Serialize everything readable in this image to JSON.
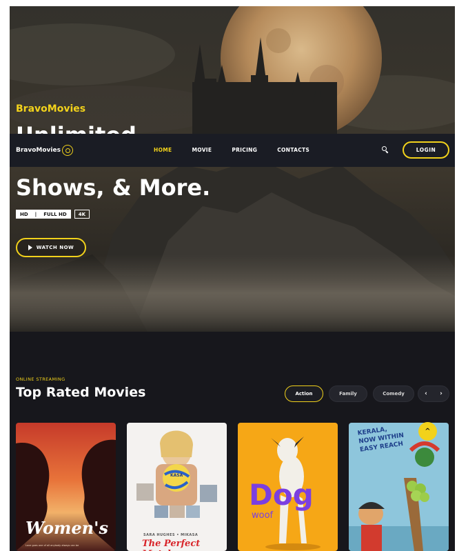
{
  "hero": {
    "kicker": "BravoMovies",
    "title_line1": "Unlimited",
    "title_line3": "Shows, & More.",
    "badges": {
      "hd": "HD",
      "sep": "|",
      "full_hd": "FULL HD",
      "k4": "4K"
    },
    "watch_label": "WATCH NOW"
  },
  "navbar": {
    "logo_text": "BravoMovies",
    "links": [
      "HOME",
      "MOVIE",
      "PRICING",
      "CONTACTS"
    ],
    "active_link": "HOME",
    "login_label": "LOGIN",
    "search_icon": "search-icon"
  },
  "section": {
    "kicker": "ONLINE STREAMING",
    "title": "Top Rated Movies",
    "filters": [
      "Action",
      "Family",
      "Comedy"
    ],
    "active_filter": "Action",
    "prev_arrow": "‹",
    "next_arrow": "›"
  },
  "cards": [
    {
      "title": "Women's",
      "caption": "Love goes one of all anybody always can be"
    },
    {
      "title": "The Perfect Match",
      "names": "SARA HUGHES • MIKASA",
      "badge": "KASA"
    },
    {
      "title": "Dog",
      "subtitle": "woof"
    },
    {
      "title": "KERALA, NOW WITHIN EASY REACH"
    }
  ],
  "scroll_top_label": "^",
  "colors": {
    "accent": "#f2d21b",
    "page_bg": "#16161c",
    "nav_bg": "#1a1c24",
    "dog_purple": "#7b3fe0",
    "dog_bg": "#f6a716"
  }
}
